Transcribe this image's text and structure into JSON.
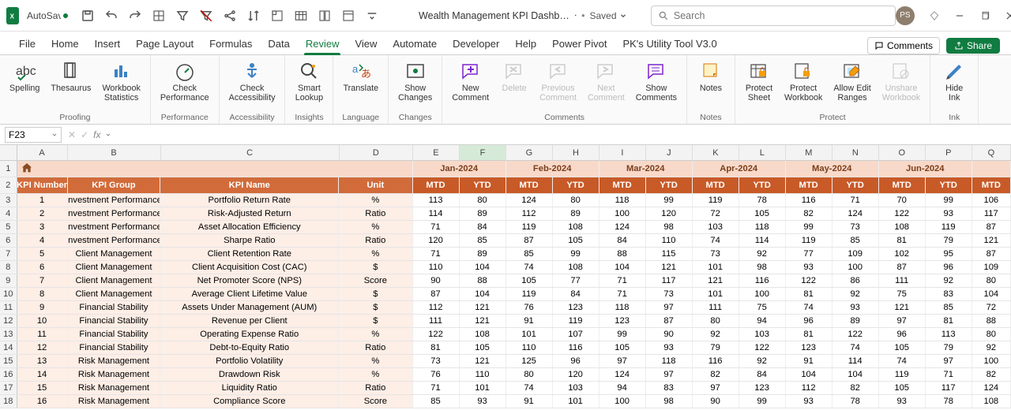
{
  "title": {
    "autosave": "AutoSave",
    "doc": "Wealth Management KPI Dashb…",
    "saved": "Saved",
    "search_ph": "Search",
    "avatar": "PS"
  },
  "tabs": [
    "File",
    "Home",
    "Insert",
    "Page Layout",
    "Formulas",
    "Data",
    "Review",
    "View",
    "Automate",
    "Developer",
    "Help",
    "Power Pivot",
    "PK's Utility Tool V3.0"
  ],
  "active_tab": "Review",
  "tabs_right": {
    "comments": "Comments",
    "share": "Share"
  },
  "ribbon": {
    "groups": [
      {
        "label": "Proofing",
        "btns": [
          {
            "id": "spelling",
            "lbl": "Spelling"
          },
          {
            "id": "thesaurus",
            "lbl": "Thesaurus"
          },
          {
            "id": "wbstats",
            "lbl": "Workbook\nStatistics"
          }
        ]
      },
      {
        "label": "Performance",
        "btns": [
          {
            "id": "checkperf",
            "lbl": "Check\nPerformance"
          }
        ]
      },
      {
        "label": "Accessibility",
        "btns": [
          {
            "id": "access",
            "lbl": "Check\nAccessibility"
          }
        ]
      },
      {
        "label": "Insights",
        "btns": [
          {
            "id": "smart",
            "lbl": "Smart\nLookup"
          }
        ]
      },
      {
        "label": "Language",
        "btns": [
          {
            "id": "translate",
            "lbl": "Translate"
          }
        ]
      },
      {
        "label": "Changes",
        "btns": [
          {
            "id": "showch",
            "lbl": "Show\nChanges"
          }
        ]
      },
      {
        "label": "Comments",
        "btns": [
          {
            "id": "newc",
            "lbl": "New\nComment"
          },
          {
            "id": "delc",
            "lbl": "Delete",
            "disabled": true
          },
          {
            "id": "prevc",
            "lbl": "Previous\nComment",
            "disabled": true
          },
          {
            "id": "nextc",
            "lbl": "Next\nComment",
            "disabled": true
          },
          {
            "id": "showc",
            "lbl": "Show\nComments"
          }
        ]
      },
      {
        "label": "Notes",
        "btns": [
          {
            "id": "notes",
            "lbl": "Notes"
          }
        ]
      },
      {
        "label": "Protect",
        "btns": [
          {
            "id": "psheet",
            "lbl": "Protect\nSheet"
          },
          {
            "id": "pwb",
            "lbl": "Protect\nWorkbook"
          },
          {
            "id": "allowedit",
            "lbl": "Allow Edit\nRanges"
          },
          {
            "id": "unshare",
            "lbl": "Unshare\nWorkbook",
            "disabled": true
          }
        ]
      },
      {
        "label": "Ink",
        "btns": [
          {
            "id": "hideink",
            "lbl": "Hide\nInk"
          }
        ]
      }
    ]
  },
  "fbar": {
    "ref": "F23"
  },
  "cols": {
    "letters": [
      "A",
      "B",
      "C",
      "D",
      "E",
      "F",
      "G",
      "H",
      "I",
      "J",
      "K",
      "L",
      "M",
      "N",
      "O",
      "P",
      "Q"
    ],
    "widths": [
      65,
      120,
      230,
      95,
      60,
      60,
      60,
      60,
      60,
      60,
      60,
      60,
      60,
      60,
      60,
      60,
      50
    ],
    "selected": "F"
  },
  "months": [
    "Jan-2024",
    "Feb-2024",
    "Mar-2024",
    "Apr-2024",
    "May-2024",
    "Jun-2024"
  ],
  "subhdr": {
    "left": [
      "KPI Number",
      "KPI Group",
      "KPI Name",
      "Unit"
    ],
    "pair": [
      "MTD",
      "YTD"
    ],
    "tail": "MTD"
  },
  "rows": [
    {
      "n": 1,
      "g": "Investment Performance",
      "name": "Portfolio Return Rate",
      "u": "%",
      "v": [
        113,
        80,
        124,
        80,
        118,
        99,
        119,
        78,
        116,
        71,
        70,
        99,
        106
      ]
    },
    {
      "n": 2,
      "g": "Investment Performance",
      "name": "Risk-Adjusted Return",
      "u": "Ratio",
      "v": [
        114,
        89,
        112,
        89,
        100,
        120,
        72,
        105,
        82,
        124,
        122,
        93,
        117
      ]
    },
    {
      "n": 3,
      "g": "Investment Performance",
      "name": "Asset Allocation Efficiency",
      "u": "%",
      "v": [
        71,
        84,
        119,
        108,
        124,
        98,
        103,
        118,
        99,
        73,
        108,
        119,
        87
      ]
    },
    {
      "n": 4,
      "g": "Investment Performance",
      "name": "Sharpe Ratio",
      "u": "Ratio",
      "v": [
        120,
        85,
        87,
        105,
        84,
        110,
        74,
        114,
        119,
        85,
        81,
        79,
        121
      ]
    },
    {
      "n": 5,
      "g": "Client Management",
      "name": "Client Retention Rate",
      "u": "%",
      "v": [
        71,
        89,
        85,
        99,
        88,
        115,
        73,
        92,
        77,
        109,
        102,
        95,
        87
      ]
    },
    {
      "n": 6,
      "g": "Client Management",
      "name": "Client Acquisition Cost (CAC)",
      "u": "$",
      "v": [
        110,
        104,
        74,
        108,
        104,
        121,
        101,
        98,
        93,
        100,
        87,
        96,
        109
      ]
    },
    {
      "n": 7,
      "g": "Client Management",
      "name": "Net Promoter Score (NPS)",
      "u": "Score",
      "v": [
        90,
        88,
        105,
        77,
        71,
        117,
        121,
        116,
        122,
        86,
        111,
        92,
        80
      ]
    },
    {
      "n": 8,
      "g": "Client Management",
      "name": "Average Client Lifetime Value",
      "u": "$",
      "v": [
        87,
        104,
        119,
        84,
        71,
        73,
        101,
        100,
        81,
        92,
        75,
        83,
        104
      ]
    },
    {
      "n": 9,
      "g": "Financial Stability",
      "name": "Assets Under Management (AUM)",
      "u": "$",
      "v": [
        112,
        121,
        76,
        123,
        118,
        97,
        111,
        75,
        74,
        93,
        121,
        85,
        72
      ]
    },
    {
      "n": 10,
      "g": "Financial Stability",
      "name": "Revenue per Client",
      "u": "$",
      "v": [
        111,
        121,
        91,
        119,
        123,
        87,
        80,
        94,
        96,
        89,
        97,
        81,
        88
      ]
    },
    {
      "n": 11,
      "g": "Financial Stability",
      "name": "Operating Expense Ratio",
      "u": "%",
      "v": [
        122,
        108,
        101,
        107,
        99,
        90,
        92,
        103,
        81,
        122,
        96,
        113,
        80
      ]
    },
    {
      "n": 12,
      "g": "Financial Stability",
      "name": "Debt-to-Equity Ratio",
      "u": "Ratio",
      "v": [
        81,
        105,
        110,
        116,
        105,
        93,
        79,
        122,
        123,
        74,
        105,
        79,
        92
      ]
    },
    {
      "n": 13,
      "g": "Risk Management",
      "name": "Portfolio Volatility",
      "u": "%",
      "v": [
        73,
        121,
        125,
        96,
        97,
        118,
        116,
        92,
        91,
        114,
        74,
        97,
        100
      ]
    },
    {
      "n": 14,
      "g": "Risk Management",
      "name": "Drawdown Risk",
      "u": "%",
      "v": [
        76,
        110,
        80,
        120,
        124,
        97,
        82,
        84,
        104,
        104,
        119,
        71,
        82
      ]
    },
    {
      "n": 15,
      "g": "Risk Management",
      "name": "Liquidity Ratio",
      "u": "Ratio",
      "v": [
        71,
        101,
        74,
        103,
        94,
        83,
        97,
        123,
        112,
        82,
        105,
        117,
        124
      ]
    },
    {
      "n": 16,
      "g": "Risk Management",
      "name": "Compliance Score",
      "u": "Score",
      "v": [
        85,
        93,
        91,
        101,
        100,
        98,
        90,
        99,
        93,
        78,
        93,
        78,
        108
      ]
    }
  ]
}
